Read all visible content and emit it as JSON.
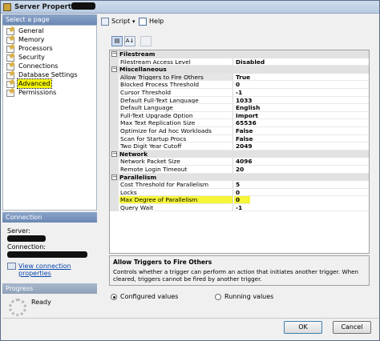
{
  "window": {
    "title": "Server Properties"
  },
  "left": {
    "select_page_header": "Select a page",
    "pages": [
      {
        "label": "General"
      },
      {
        "label": "Memory"
      },
      {
        "label": "Processors"
      },
      {
        "label": "Security"
      },
      {
        "label": "Connections"
      },
      {
        "label": "Database Settings"
      },
      {
        "label": "Advanced",
        "selected": true
      },
      {
        "label": "Permissions"
      }
    ],
    "connection_header": "Connection",
    "server_label": "Server:",
    "connection_label": "Connection:",
    "view_connection_properties": "View connection properties",
    "progress_header": "Progress",
    "progress_status": "Ready"
  },
  "toolbar": {
    "script_label": "Script",
    "help_label": "Help",
    "caret": "▾"
  },
  "grid_toolbar": {
    "categorized_icon": "categorized-icon",
    "alpha_icon": "alpha-sort-icon",
    "pages_icon": "property-pages-icon",
    "alpha_text": "A↓"
  },
  "grid": {
    "categories": [
      {
        "name": "Filestream",
        "rows": [
          {
            "name": "Filestream Access Level",
            "value": "Disabled"
          }
        ]
      },
      {
        "name": "Miscellaneous",
        "rows": [
          {
            "name": "Allow Triggers to Fire Others",
            "value": "True",
            "selected": true
          },
          {
            "name": "Blocked Process Threshold",
            "value": "0"
          },
          {
            "name": "Cursor Threshold",
            "value": "-1"
          },
          {
            "name": "Default Full-Text Language",
            "value": "1033"
          },
          {
            "name": "Default Language",
            "value": "English"
          },
          {
            "name": "Full-Text Upgrade Option",
            "value": "Import"
          },
          {
            "name": "Max Text Replication Size",
            "value": "65536"
          },
          {
            "name": "Optimize for Ad hoc Workloads",
            "value": "False"
          },
          {
            "name": "Scan for Startup Procs",
            "value": "False"
          },
          {
            "name": "Two Digit Year Cutoff",
            "value": "2049"
          }
        ]
      },
      {
        "name": "Network",
        "rows": [
          {
            "name": "Network Packet Size",
            "value": "4096"
          },
          {
            "name": "Remote Login Timeout",
            "value": "20"
          }
        ]
      },
      {
        "name": "Parallelism",
        "rows": [
          {
            "name": "Cost Threshold for Parallelism",
            "value": "5"
          },
          {
            "name": "Locks",
            "value": "0"
          },
          {
            "name": "Max Degree of Parallelism",
            "value": "0",
            "highlighted": true
          },
          {
            "name": "Query Wait",
            "value": "-1"
          }
        ]
      }
    ],
    "collapse_glyph": "−"
  },
  "description": {
    "title": "Allow Triggers to Fire Others",
    "text": "Controls whether a trigger can perform an action that initiates another trigger. When cleared, triggers cannot be fired by another trigger."
  },
  "view_mode": {
    "configured_label": "Configured values",
    "running_label": "Running values",
    "selected": "configured"
  },
  "buttons": {
    "ok": "OK",
    "cancel": "Cancel"
  },
  "colors": {
    "highlight": "#f5f53a",
    "header_blue": "#6b88b4",
    "link": "#0645ad"
  }
}
